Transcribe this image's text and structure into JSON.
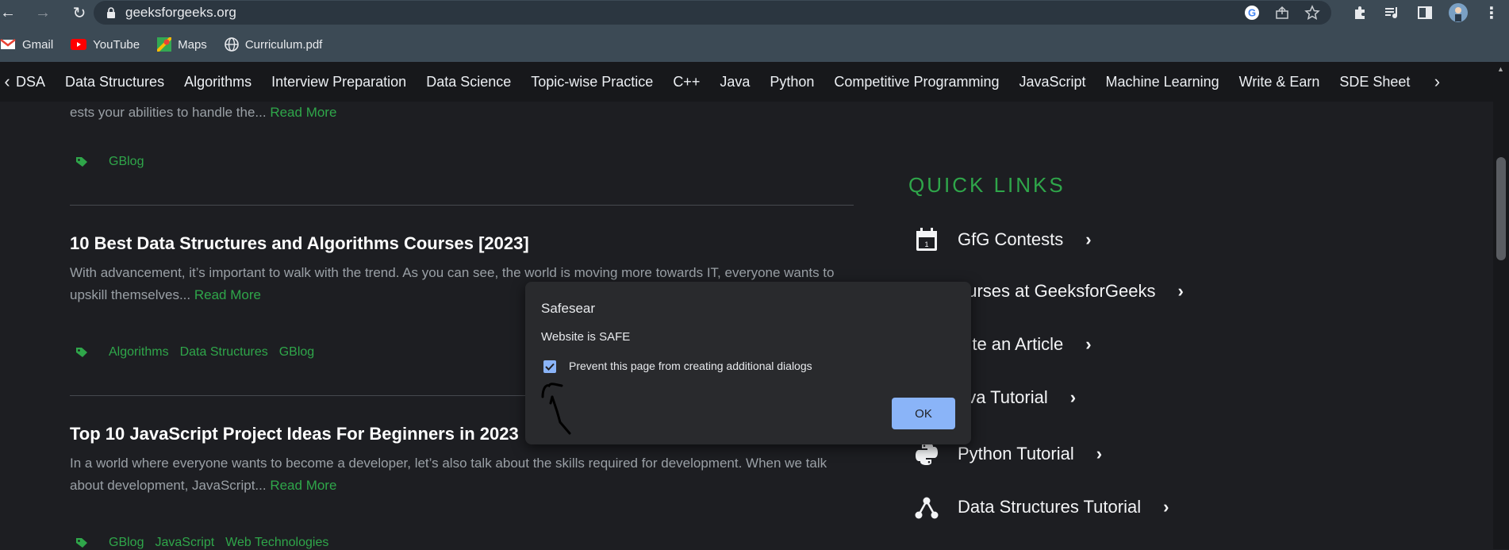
{
  "browser": {
    "url": "geeksforgeeks.org",
    "bookmarks": [
      {
        "label": "Gmail",
        "icon": "gmail-icon"
      },
      {
        "label": "YouTube",
        "icon": "youtube-icon"
      },
      {
        "label": "Maps",
        "icon": "maps-icon"
      },
      {
        "label": "Curriculum.pdf",
        "icon": "globe-icon"
      }
    ]
  },
  "nav": {
    "items": [
      "DSA",
      "Data Structures",
      "Algorithms",
      "Interview Preparation",
      "Data Science",
      "Topic-wise Practice",
      "C++",
      "Java",
      "Python",
      "Competitive Programming",
      "JavaScript",
      "Machine Learning",
      "Write & Earn",
      "SDE Sheet"
    ]
  },
  "articles": {
    "first_body": "ests your abilities to handle the...",
    "first_tags": [
      "GBlog"
    ],
    "read_more": "Read More",
    "items": [
      {
        "title": "10 Best Data Structures and Algorithms Courses [2023]",
        "body": "With advancement, it’s important to walk with the trend. As you can see, the world is moving more towards IT, everyone wants to upskill themselves...",
        "tags": [
          "Algorithms",
          "Data Structures",
          "GBlog"
        ]
      },
      {
        "title": "Top 10 JavaScript Project Ideas For Beginners in 2023",
        "body": "In a world where everyone wants to become a developer, let’s also talk about the skills required for development. When we talk about development, JavaScript...",
        "tags": [
          "GBlog",
          "JavaScript",
          "Web Technologies"
        ]
      }
    ]
  },
  "quick_links": {
    "title": "QUICK LINKS",
    "items": [
      {
        "label": "GfG Contests",
        "icon": "calendar-icon"
      },
      {
        "label": "ourses at GeeksforGeeks",
        "icon": "none"
      },
      {
        "label": "/rite an Article",
        "icon": "none"
      },
      {
        "label": "ava Tutorial",
        "icon": "none"
      },
      {
        "label": "Python Tutorial",
        "icon": "python-icon"
      },
      {
        "label": "Data Structures Tutorial",
        "icon": "tree-icon"
      }
    ]
  },
  "dialog": {
    "title": "Safesear",
    "message": "Website is SAFE",
    "checkbox_label": "Prevent this page from creating additional dialogs",
    "checkbox_checked": true,
    "ok_label": "OK"
  },
  "colors": {
    "accent": "#2fa64a",
    "dialog_button": "#8ab4f8",
    "background": "#1d1e22"
  }
}
